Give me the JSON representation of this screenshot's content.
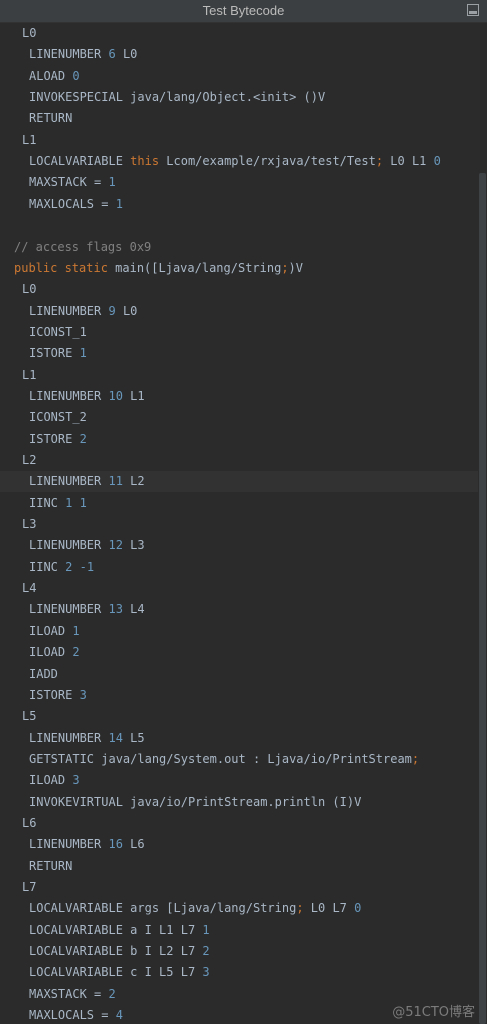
{
  "window": {
    "title": "Test Bytecode",
    "restore_icon": "restore-window-icon"
  },
  "code_lines": [
    {
      "indent": 1,
      "tokens": [
        {
          "t": "L0",
          "c": "plain"
        }
      ]
    },
    {
      "indent": 2,
      "tokens": [
        {
          "t": "LINENUMBER ",
          "c": "plain"
        },
        {
          "t": "6",
          "c": "num"
        },
        {
          "t": " L0",
          "c": "plain"
        }
      ]
    },
    {
      "indent": 2,
      "tokens": [
        {
          "t": "ALOAD ",
          "c": "plain"
        },
        {
          "t": "0",
          "c": "num"
        }
      ]
    },
    {
      "indent": 2,
      "tokens": [
        {
          "t": "INVOKESPECIAL java/lang/Object.<init> ()V",
          "c": "plain"
        }
      ]
    },
    {
      "indent": 2,
      "tokens": [
        {
          "t": "RETURN",
          "c": "plain"
        }
      ]
    },
    {
      "indent": 1,
      "tokens": [
        {
          "t": "L1",
          "c": "plain"
        }
      ]
    },
    {
      "indent": 2,
      "tokens": [
        {
          "t": "LOCALVARIABLE ",
          "c": "plain"
        },
        {
          "t": "this",
          "c": "kw"
        },
        {
          "t": " Lcom/example/rxjava/test/Test",
          "c": "plain"
        },
        {
          "t": ";",
          "c": "kw"
        },
        {
          "t": " L0 L1 ",
          "c": "plain"
        },
        {
          "t": "0",
          "c": "num"
        }
      ]
    },
    {
      "indent": 2,
      "tokens": [
        {
          "t": "MAXSTACK = ",
          "c": "plain"
        },
        {
          "t": "1",
          "c": "num"
        }
      ]
    },
    {
      "indent": 2,
      "tokens": [
        {
          "t": "MAXLOCALS = ",
          "c": "plain"
        },
        {
          "t": "1",
          "c": "num"
        }
      ]
    },
    {
      "indent": 0,
      "tokens": []
    },
    {
      "indent": 0,
      "tokens": [
        {
          "t": "// access flags 0x9",
          "c": "cmt"
        }
      ]
    },
    {
      "indent": 0,
      "tokens": [
        {
          "t": "public static",
          "c": "kw"
        },
        {
          "t": " main([Ljava/lang/String",
          "c": "plain"
        },
        {
          "t": ";",
          "c": "kw"
        },
        {
          "t": ")V",
          "c": "plain"
        }
      ]
    },
    {
      "indent": 1,
      "tokens": [
        {
          "t": "L0",
          "c": "plain"
        }
      ]
    },
    {
      "indent": 2,
      "tokens": [
        {
          "t": "LINENUMBER ",
          "c": "plain"
        },
        {
          "t": "9",
          "c": "num"
        },
        {
          "t": " L0",
          "c": "plain"
        }
      ]
    },
    {
      "indent": 2,
      "tokens": [
        {
          "t": "ICONST_1",
          "c": "plain"
        }
      ]
    },
    {
      "indent": 2,
      "tokens": [
        {
          "t": "ISTORE ",
          "c": "plain"
        },
        {
          "t": "1",
          "c": "num"
        }
      ]
    },
    {
      "indent": 1,
      "tokens": [
        {
          "t": "L1",
          "c": "plain"
        }
      ]
    },
    {
      "indent": 2,
      "tokens": [
        {
          "t": "LINENUMBER ",
          "c": "plain"
        },
        {
          "t": "10",
          "c": "num"
        },
        {
          "t": " L1",
          "c": "plain"
        }
      ]
    },
    {
      "indent": 2,
      "tokens": [
        {
          "t": "ICONST_2",
          "c": "plain"
        }
      ]
    },
    {
      "indent": 2,
      "tokens": [
        {
          "t": "ISTORE ",
          "c": "plain"
        },
        {
          "t": "2",
          "c": "num"
        }
      ]
    },
    {
      "indent": 1,
      "tokens": [
        {
          "t": "L2",
          "c": "plain"
        }
      ]
    },
    {
      "indent": 2,
      "highlight": true,
      "tokens": [
        {
          "t": "LINENUMBER ",
          "c": "plain"
        },
        {
          "t": "11",
          "c": "num"
        },
        {
          "t": " L2",
          "c": "plain"
        }
      ]
    },
    {
      "indent": 2,
      "tokens": [
        {
          "t": "IINC ",
          "c": "plain"
        },
        {
          "t": "1",
          "c": "num"
        },
        {
          "t": " ",
          "c": "plain"
        },
        {
          "t": "1",
          "c": "num"
        }
      ]
    },
    {
      "indent": 1,
      "tokens": [
        {
          "t": "L3",
          "c": "plain"
        }
      ]
    },
    {
      "indent": 2,
      "tokens": [
        {
          "t": "LINENUMBER ",
          "c": "plain"
        },
        {
          "t": "12",
          "c": "num"
        },
        {
          "t": " L3",
          "c": "plain"
        }
      ]
    },
    {
      "indent": 2,
      "tokens": [
        {
          "t": "IINC ",
          "c": "plain"
        },
        {
          "t": "2",
          "c": "num"
        },
        {
          "t": " ",
          "c": "plain"
        },
        {
          "t": "-1",
          "c": "num"
        }
      ]
    },
    {
      "indent": 1,
      "tokens": [
        {
          "t": "L4",
          "c": "plain"
        }
      ]
    },
    {
      "indent": 2,
      "tokens": [
        {
          "t": "LINENUMBER ",
          "c": "plain"
        },
        {
          "t": "13",
          "c": "num"
        },
        {
          "t": " L4",
          "c": "plain"
        }
      ]
    },
    {
      "indent": 2,
      "tokens": [
        {
          "t": "ILOAD ",
          "c": "plain"
        },
        {
          "t": "1",
          "c": "num"
        }
      ]
    },
    {
      "indent": 2,
      "tokens": [
        {
          "t": "ILOAD ",
          "c": "plain"
        },
        {
          "t": "2",
          "c": "num"
        }
      ]
    },
    {
      "indent": 2,
      "tokens": [
        {
          "t": "IADD",
          "c": "plain"
        }
      ]
    },
    {
      "indent": 2,
      "tokens": [
        {
          "t": "ISTORE ",
          "c": "plain"
        },
        {
          "t": "3",
          "c": "num"
        }
      ]
    },
    {
      "indent": 1,
      "tokens": [
        {
          "t": "L5",
          "c": "plain"
        }
      ]
    },
    {
      "indent": 2,
      "tokens": [
        {
          "t": "LINENUMBER ",
          "c": "plain"
        },
        {
          "t": "14",
          "c": "num"
        },
        {
          "t": " L5",
          "c": "plain"
        }
      ]
    },
    {
      "indent": 2,
      "tokens": [
        {
          "t": "GETSTATIC java/lang/System.out : Ljava/io/PrintStream",
          "c": "plain"
        },
        {
          "t": ";",
          "c": "kw"
        }
      ]
    },
    {
      "indent": 2,
      "tokens": [
        {
          "t": "ILOAD ",
          "c": "plain"
        },
        {
          "t": "3",
          "c": "num"
        }
      ]
    },
    {
      "indent": 2,
      "tokens": [
        {
          "t": "INVOKEVIRTUAL java/io/PrintStream.println (I)V",
          "c": "plain"
        }
      ]
    },
    {
      "indent": 1,
      "tokens": [
        {
          "t": "L6",
          "c": "plain"
        }
      ]
    },
    {
      "indent": 2,
      "tokens": [
        {
          "t": "LINENUMBER ",
          "c": "plain"
        },
        {
          "t": "16",
          "c": "num"
        },
        {
          "t": " L6",
          "c": "plain"
        }
      ]
    },
    {
      "indent": 2,
      "tokens": [
        {
          "t": "RETURN",
          "c": "plain"
        }
      ]
    },
    {
      "indent": 1,
      "tokens": [
        {
          "t": "L7",
          "c": "plain"
        }
      ]
    },
    {
      "indent": 2,
      "tokens": [
        {
          "t": "LOCALVARIABLE args [Ljava/lang/String",
          "c": "plain"
        },
        {
          "t": ";",
          "c": "kw"
        },
        {
          "t": " L0 L7 ",
          "c": "plain"
        },
        {
          "t": "0",
          "c": "num"
        }
      ]
    },
    {
      "indent": 2,
      "tokens": [
        {
          "t": "LOCALVARIABLE a I L1 L7 ",
          "c": "plain"
        },
        {
          "t": "1",
          "c": "num"
        }
      ]
    },
    {
      "indent": 2,
      "tokens": [
        {
          "t": "LOCALVARIABLE b I L2 L7 ",
          "c": "plain"
        },
        {
          "t": "2",
          "c": "num"
        }
      ]
    },
    {
      "indent": 2,
      "tokens": [
        {
          "t": "LOCALVARIABLE c I L5 L7 ",
          "c": "plain"
        },
        {
          "t": "3",
          "c": "num"
        }
      ]
    },
    {
      "indent": 2,
      "tokens": [
        {
          "t": "MAXSTACK = ",
          "c": "plain"
        },
        {
          "t": "2",
          "c": "num"
        }
      ]
    },
    {
      "indent": 2,
      "tokens": [
        {
          "t": "MAXLOCALS = ",
          "c": "plain"
        },
        {
          "t": "4",
          "c": "num"
        }
      ]
    }
  ],
  "watermark": "@51CTO博客"
}
